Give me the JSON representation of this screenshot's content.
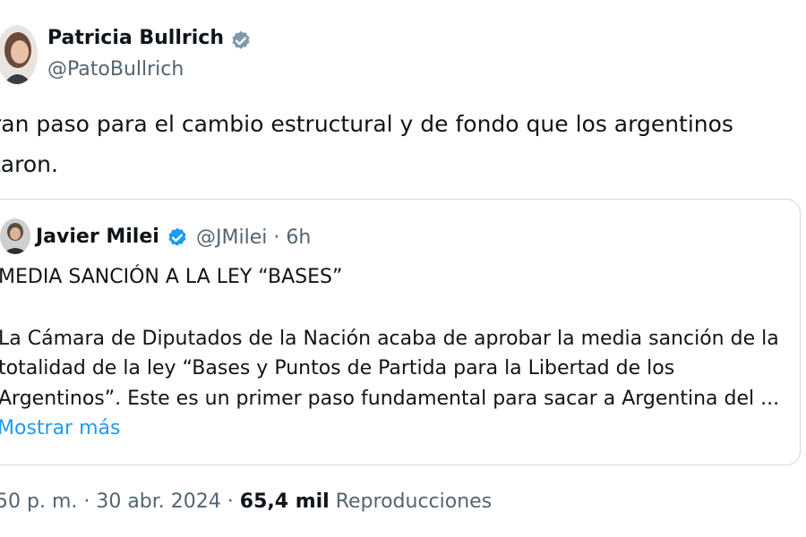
{
  "author": {
    "name": "Patricia Bullrich",
    "handle": "@PatoBullrich",
    "verified_icon": "verified-badge-icon"
  },
  "tweet": {
    "lines": [
      "ran paso para el cambio estructural y de fondo que los argentinos",
      "taron."
    ]
  },
  "quote": {
    "name": "Javier Milei",
    "handle": "@JMilei",
    "time": "6h",
    "title": "MEDIA SANCIÓN A LA LEY “BASES”",
    "body_lines": [
      "La Cámara de Diputados de la Nación acaba de aprobar la media sanción de la",
      "totalidad de la ley “Bases y Puntos de Partida para la Libertad de los",
      "Argentinos”. Este es un primer paso fundamental para sacar a Argentina del ..."
    ],
    "show_more": "Mostrar más"
  },
  "footer": {
    "time_date": "50 p. m. · 30 abr. 2024 · ",
    "views_count": "65,4 mil",
    "views_label": "Reproducciones"
  },
  "colors": {
    "text": "#0f1419",
    "secondary": "#536471",
    "link": "#1d9bf0",
    "border": "#cfd9de"
  }
}
